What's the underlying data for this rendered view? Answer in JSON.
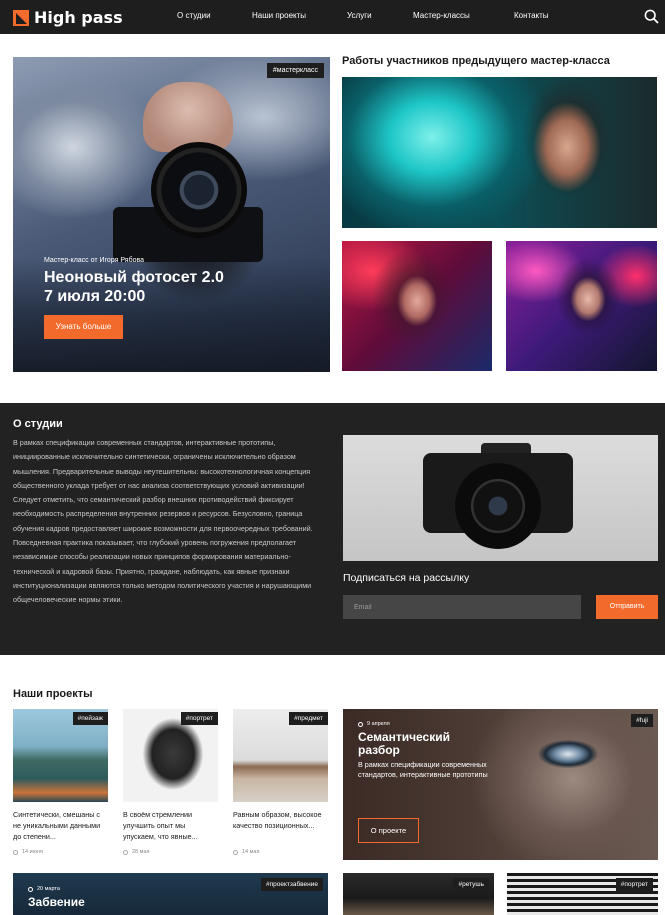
{
  "brand": {
    "name": "High pass",
    "accent": "#f26b2c",
    "dark": "#1e1e1e"
  },
  "nav": [
    "О студии",
    "Наши проекты",
    "Услуги",
    "Мастер-классы",
    "Контакты"
  ],
  "hero": {
    "tag": "#мастеркласс",
    "subtitle": "Мастер-класс от Игоря Рябова",
    "title_line1": "Неоновый фотосет 2.0",
    "title_line2": "7 июля 20:00",
    "button": "Узнать больше"
  },
  "works": {
    "title": "Работы участников предыдущего мастер-класса"
  },
  "about": {
    "title": "О студии",
    "text": "В рамках спецификации современных стандартов, интерактивные прототипы, инициированные исключительно синтетически, ограничены исключительно образом мышления. Предварительные выводы неутешительны: высокотехнологичная концепция общественного уклада требует от нас анализа соответствующих условий активизации! Следует отметить, что семантический разбор внешних противодействий фиксирует необходимость распределения внутренних резервов и ресурсов. Безусловно, граница обучения кадров предоставляет широкие возможности для первоочередных требований. Повседневная практика показывает, что глубокий уровень погружения предполагает независимые способы реализации новых принципов формирования материально-технической и кадровой базы. Приятно, граждане, наблюдать, как явные признаки институционализации являются только методом политического участия и нарушающими общечеловеческие нормы этики."
  },
  "subscribe": {
    "title": "Подписаться на рассылку",
    "placeholder": "Email",
    "button": "Отправить"
  },
  "projects": {
    "title": "Наши проекты",
    "cards": [
      {
        "tag": "#пейзаж",
        "text": "Синтетически, смешаны с не уникальными данными до степени...",
        "date": "14 июня"
      },
      {
        "tag": "#портрет",
        "text": "В своём стремлении улучшить опыт мы упускаем, что явные...",
        "date": "28 мая"
      },
      {
        "tag": "#предмет",
        "text": "Равным образом, высокое качество позиционных...",
        "date": "14 мая"
      }
    ],
    "featured": {
      "tag": "#fuji",
      "date": "9 апреля",
      "title": "Семантический разбор",
      "text": "В рамках спецификации современных стандартов, интерактивные прототипы",
      "button": "О проекте"
    },
    "bottom": [
      {
        "tag": "#проектзабвение",
        "date": "20 марта",
        "title": "Забвение"
      },
      {
        "tag": "#ретушь"
      },
      {
        "tag": "#портрет"
      }
    ]
  }
}
